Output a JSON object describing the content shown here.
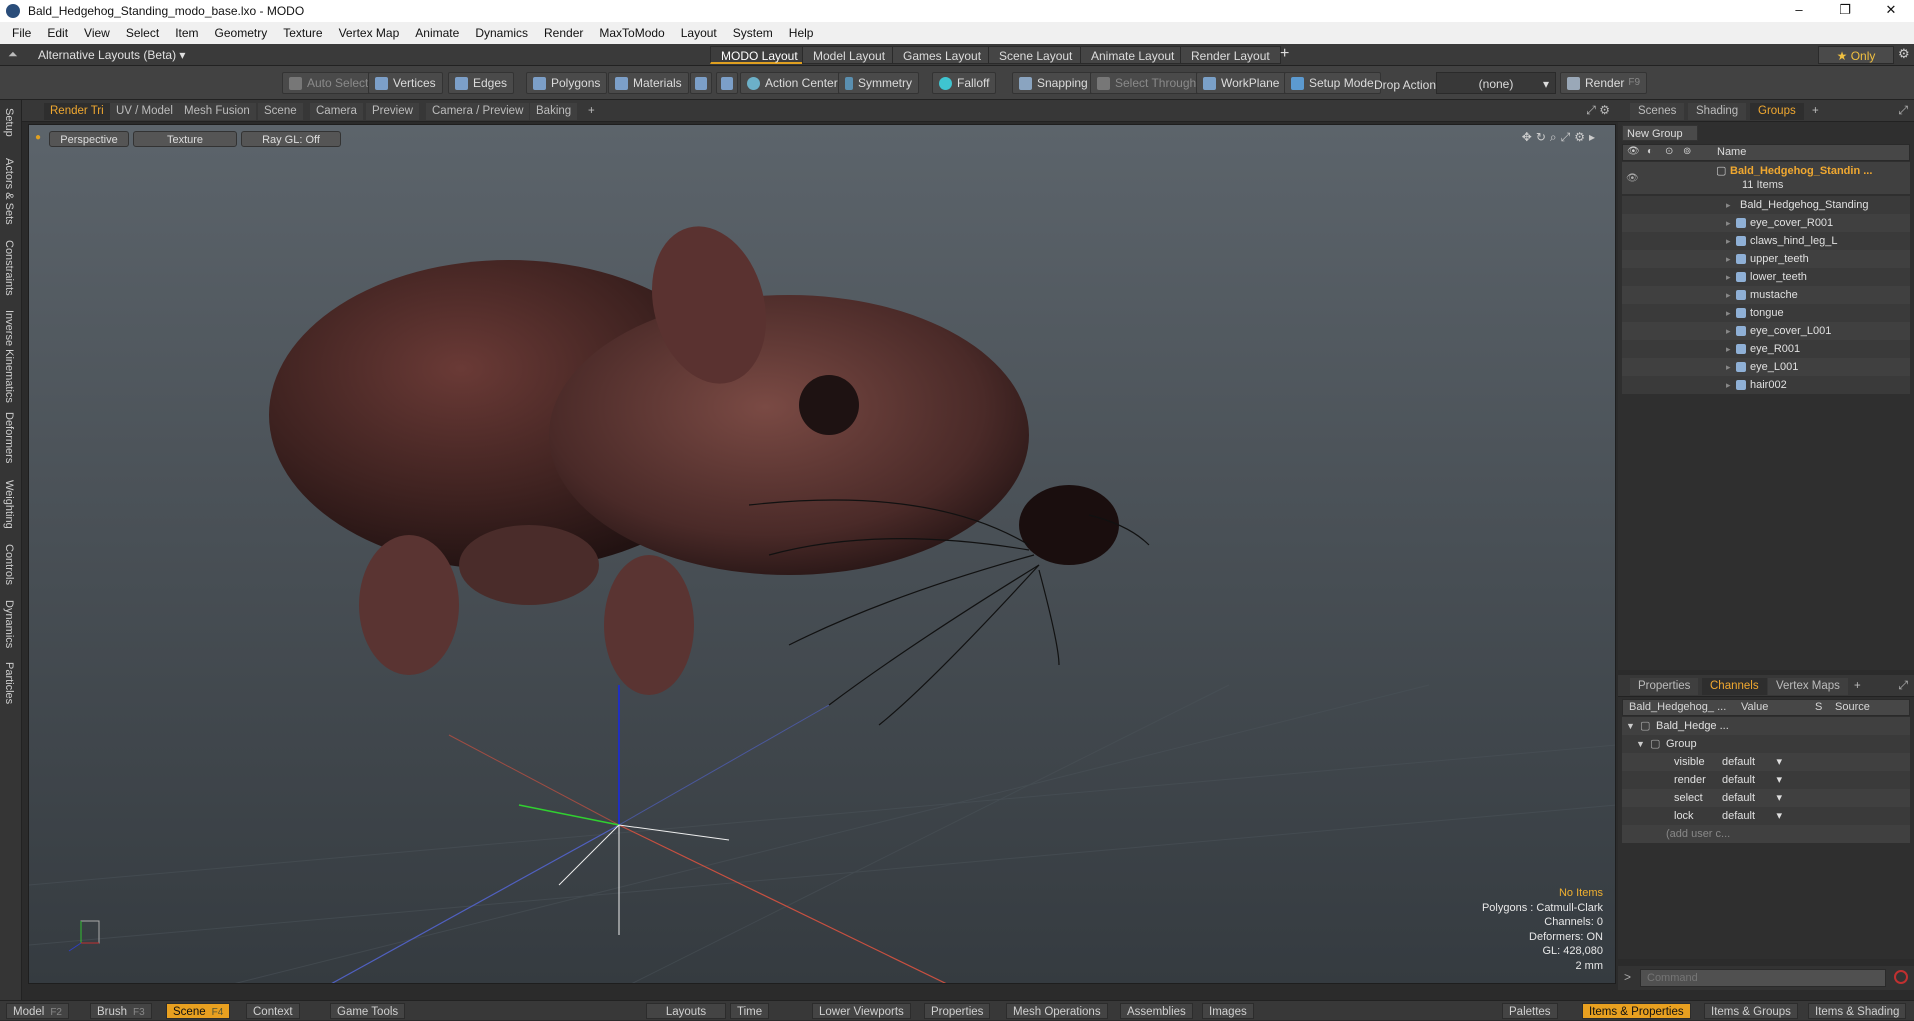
{
  "window": {
    "title": "Bald_Hedgehog_Standing_modo_base.lxo - MODO",
    "controls": [
      "–",
      "❐",
      "✕"
    ]
  },
  "menu": [
    "File",
    "Edit",
    "View",
    "Select",
    "Item",
    "Geometry",
    "Texture",
    "Vertex Map",
    "Animate",
    "Dynamics",
    "Render",
    "MaxToModo",
    "Layout",
    "System",
    "Help"
  ],
  "layoutbar": {
    "alt_layouts": "Alternative Layouts (Beta)",
    "tabs": [
      "MODO Layout",
      "Model Layout",
      "Games Layout",
      "Scene Layout",
      "Animate Layout",
      "Render Layout"
    ],
    "add": "+",
    "only": "★ Only"
  },
  "toolbar": {
    "auto_select": "Auto Select",
    "vertices": "Vertices",
    "edges": "Edges",
    "polygons": "Polygons",
    "materials": "Materials",
    "action_center": "Action Center",
    "symmetry": "Symmetry",
    "falloff": "Falloff",
    "snapping": "Snapping",
    "select_through": "Select Through",
    "workplane": "WorkPlane",
    "setup_mode": "Setup Mode",
    "drop_action": "Drop Action",
    "drop_value": "(none)",
    "render": "Render",
    "render_key": "F9"
  },
  "left_tabs": [
    "Setup",
    "Actors & Sets",
    "Constraints",
    "Inverse Kinematics",
    "Deformers",
    "Weighting",
    "Controls",
    "Dynamics",
    "Particles"
  ],
  "viewport_tabs": [
    "Render Tri",
    "UV / Model",
    "Mesh Fusion",
    "Scene",
    "Camera",
    "Preview",
    "Camera / Preview",
    "Baking",
    "+"
  ],
  "viewport": {
    "perspective": "Perspective",
    "texture": "Texture",
    "raygl": "Ray GL: Off",
    "info": {
      "no_items": "No Items",
      "polygons": "Polygons : Catmull-Clark",
      "channels": "Channels: 0",
      "deformers": "Deformers: ON",
      "gl": "GL: 428,080",
      "scale": "2 mm"
    }
  },
  "right_tabs_top": [
    "Scenes",
    "Shading",
    "Groups",
    "+"
  ],
  "groups": {
    "new_group": "New Group",
    "name_header": "Name",
    "group_name": "Bald_Hedgehog_Standin ...",
    "item_count": "11 Items",
    "items": [
      "Bald_Hedgehog_Standing",
      "eye_cover_R001",
      "claws_hind_leg_L",
      "upper_teeth",
      "lower_teeth",
      "mustache",
      "tongue",
      "eye_cover_L001",
      "eye_R001",
      "eye_L001",
      "hair002"
    ]
  },
  "right_tabs_bottom": [
    "Properties",
    "Channels",
    "Vertex Maps",
    "+"
  ],
  "channels": {
    "headers": [
      "Bald_Hedgehog_ ...",
      "Value",
      "S",
      "Source"
    ],
    "root": "Bald_Hedge ...",
    "group": "Group",
    "rows": [
      {
        "name": "visible",
        "value": "default"
      },
      {
        "name": "render",
        "value": "default"
      },
      {
        "name": "select",
        "value": "default"
      },
      {
        "name": "lock",
        "value": "default"
      }
    ],
    "add_user": "(add user c..."
  },
  "command": {
    "placeholder": "Command"
  },
  "bottombar": {
    "model": "Model",
    "model_key": "F2",
    "brush": "Brush",
    "brush_key": "F3",
    "scene": "Scene",
    "scene_key": "F4",
    "context": "Context",
    "game_tools": "Game Tools",
    "layouts": "Layouts",
    "time": "Time",
    "lower_viewports": "Lower Viewports",
    "properties": "Properties",
    "mesh_ops": "Mesh Operations",
    "assemblies": "Assemblies",
    "images": "Images",
    "palettes": "Palettes",
    "items_props": "Items & Properties",
    "items_groups": "Items & Groups",
    "items_shading": "Items & Shading"
  }
}
